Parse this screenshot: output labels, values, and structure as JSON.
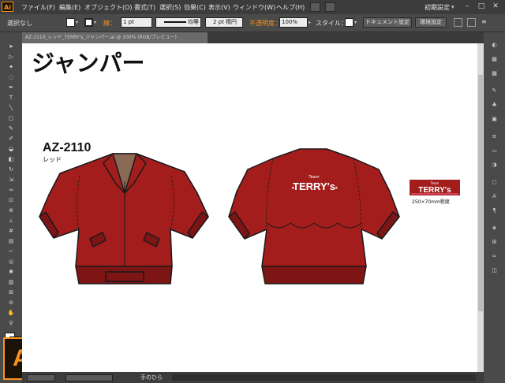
{
  "app": {
    "logo": "Ai",
    "big_logo": "Ai",
    "workspace": "初期設定"
  },
  "menu": [
    "ファイル(F)",
    "編集(E)",
    "オブジェクト(O)",
    "書式(T)",
    "選択(S)",
    "効果(C)",
    "表示(V)",
    "ウィンドウ(W)",
    "ヘルプ(H)"
  ],
  "control": {
    "selection": "選択なし",
    "stroke_label": "線：",
    "stroke_weight": "1 pt",
    "stroke_style": "均等",
    "brush": "2 pt 楕円",
    "opacity_label": "不透明度：",
    "opacity_value": "100%",
    "style_label": "スタイル：",
    "doc_setup": "ドキュメント設定",
    "prefs": "環境設定"
  },
  "tab": {
    "filename": "AZ-2110_レッド_TERRY's_ジャンパー.ai @ 100% (RGB/プレビュー)"
  },
  "canvas": {
    "title": "ジャンパー",
    "model": "AZ-2110",
    "color_name": "レッド",
    "print_team": "Team",
    "print_name": "TERRY's",
    "sample_team": "Team",
    "sample_name": "TERRY's",
    "print_size": "250×70mm程度"
  },
  "status": {
    "tool": "手のひら"
  },
  "colors": {
    "jacket": "#a31d1d",
    "jacket_dark": "#7d1515",
    "accent": "#f7941d",
    "stripe": "#ff6699"
  }
}
